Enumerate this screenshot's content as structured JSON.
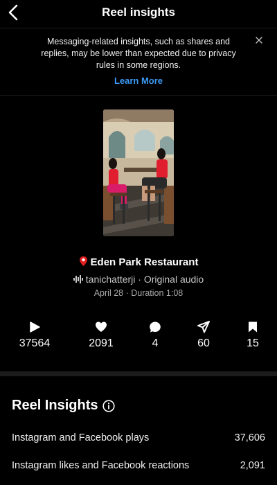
{
  "header": {
    "title": "Reel insights"
  },
  "notice": {
    "text": "Messaging-related insights, such as shares and replies, may be lower than expected due to privacy rules in some regions.",
    "link": "Learn More"
  },
  "reel": {
    "location": "Eden Park Restaurant",
    "audio": "tanichatterji · Original audio",
    "meta": "April 28 · Duration 1:08"
  },
  "stats": [
    {
      "icon": "play-icon",
      "value": "37564"
    },
    {
      "icon": "heart-icon",
      "value": "2091"
    },
    {
      "icon": "comment-icon",
      "value": "4"
    },
    {
      "icon": "share-icon",
      "value": "60"
    },
    {
      "icon": "bookmark-icon",
      "value": "15"
    }
  ],
  "insights": {
    "title": "Reel Insights",
    "rows": [
      {
        "label": "Instagram and Facebook plays",
        "value": "37,606"
      },
      {
        "label": "Instagram likes and Facebook reactions",
        "value": "2,091"
      }
    ]
  },
  "colors": {
    "background": "#000000",
    "link": "#3d9af5",
    "divider": "#1c1c1c"
  }
}
